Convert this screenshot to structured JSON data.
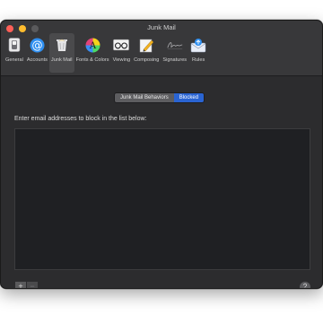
{
  "window": {
    "title": "Junk Mail"
  },
  "toolbar": {
    "items": [
      {
        "label": "General",
        "icon": "switch-icon"
      },
      {
        "label": "Accounts",
        "icon": "at-icon"
      },
      {
        "label": "Junk Mail",
        "icon": "trash-icon",
        "active": true
      },
      {
        "label": "Fonts & Colors",
        "icon": "color-wheel-icon"
      },
      {
        "label": "Viewing",
        "icon": "glasses-icon"
      },
      {
        "label": "Composing",
        "icon": "pencil-icon"
      },
      {
        "label": "Signatures",
        "icon": "signature-icon"
      },
      {
        "label": "Rules",
        "icon": "envelope-badge-icon"
      }
    ]
  },
  "segments": {
    "behaviors": "Junk Mail Behaviors",
    "blocked": "Blocked"
  },
  "main": {
    "prompt": "Enter email addresses to block in the list below:",
    "add_label": "+",
    "remove_label": "−",
    "help_label": "?"
  },
  "colors": {
    "accent": "#2a64d2",
    "window_bg": "#2c2c2e",
    "list_bg": "#1f2023"
  }
}
